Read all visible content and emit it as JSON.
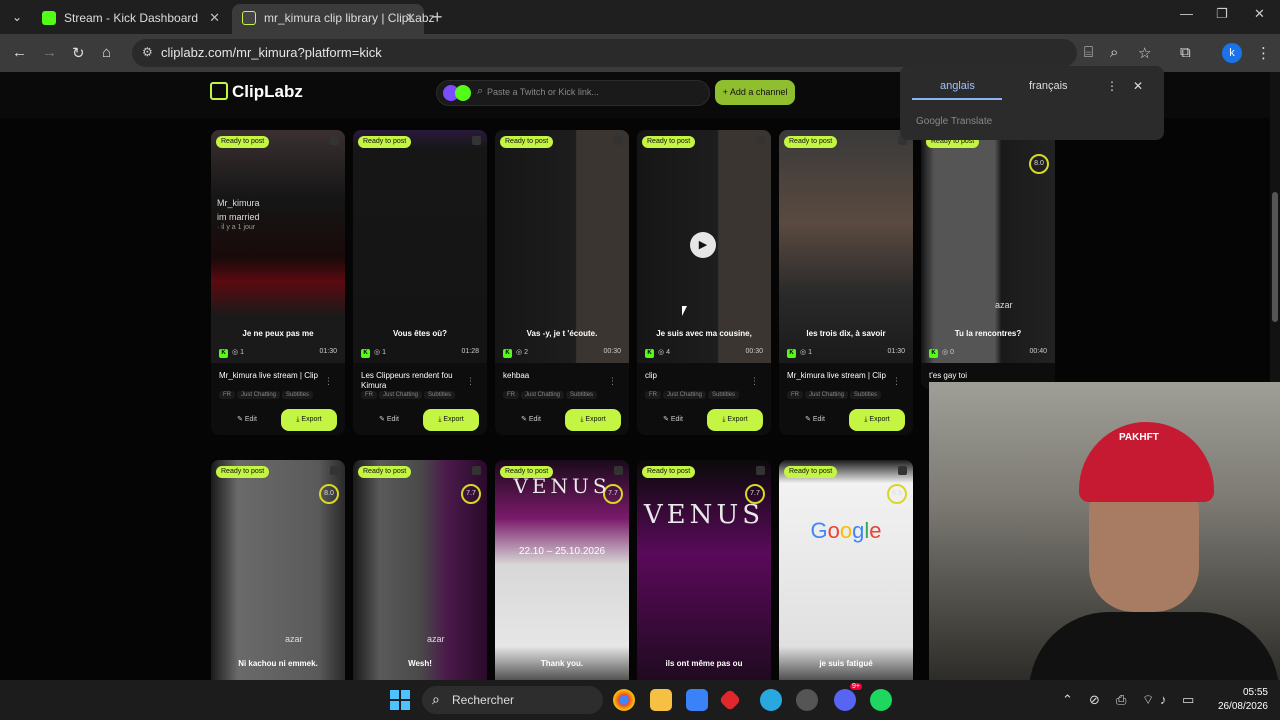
{
  "browser": {
    "tabs": [
      {
        "title": "Stream - Kick Dashboard",
        "favicon_color": "#53fc18"
      },
      {
        "title": "mr_kimura clip library | ClipLabz",
        "favicon_color": "#111111"
      }
    ],
    "url": "cliplabz.com/mr_kimura?platform=kick"
  },
  "app": {
    "brand": "ClipLabz",
    "search_placeholder": "Paste a Twitch or Kick link...",
    "add_channel": "+ Add a channel"
  },
  "translate": {
    "lang_source": "anglais",
    "lang_target": "français",
    "provider": "Google Translate"
  },
  "clips": [
    {
      "caption": "Je ne peux pas me",
      "views": "1",
      "duration": "01:30",
      "title": "Mr_kimura live stream | Clip",
      "overlay_name": "Mr_kimura",
      "overlay_sub": "im married",
      "overlay_time": "· il y a 1 jour"
    },
    {
      "caption": "Vous êtes où?",
      "views": "1",
      "duration": "01:28",
      "title": "Les Clippeurs rendent fou Kimura"
    },
    {
      "caption": "Vas -y, je t 'écoute.",
      "views": "2",
      "duration": "00:30",
      "title": "kehbaa"
    },
    {
      "caption": "Je suis avec ma cousine,",
      "views": "4",
      "duration": "00:30",
      "title": "clip"
    },
    {
      "caption": "les trois dix, à savoir",
      "views": "1",
      "duration": "01:30",
      "title": "Mr_kimura live stream | Clip"
    },
    {
      "caption": "Tu la rencontres?",
      "views": "0",
      "duration": "00:40",
      "title": "t'es gay toi",
      "score": "8.0",
      "overlay_name": "azar"
    }
  ],
  "clips_row2": [
    {
      "caption": "Ni kachou ni emmek.",
      "score": "8.0",
      "overlay_name": "azar"
    },
    {
      "caption": "Wesh!",
      "score": "7.7",
      "overlay_name": "azar"
    },
    {
      "caption": "Thank you.",
      "score": "7.7",
      "venus": "VENUS",
      "dates": "22.10 – 25.10.2026"
    },
    {
      "caption": "ils ont même pas ou",
      "score": "7.7",
      "venus": "VENUS"
    },
    {
      "caption": "je suis fatigué",
      "score": "6.9",
      "google": "Google"
    }
  ],
  "labels": {
    "ready": "Ready to post",
    "lang": "FR",
    "tag1": "Just Chatting",
    "tag2": "Subtitles",
    "edit": "Edit",
    "export": "Export"
  },
  "webcam": {
    "cap_text": "PAKHFT"
  },
  "taskbar": {
    "search_placeholder": "Rechercher",
    "time": "05:55",
    "date": "26/08/2026",
    "discord_badge": "9+"
  },
  "colors": {
    "accent": "#c4f542",
    "kick_green": "#53fc18",
    "chrome_bg": "#1f1f1f",
    "page_bg": "#050505"
  }
}
